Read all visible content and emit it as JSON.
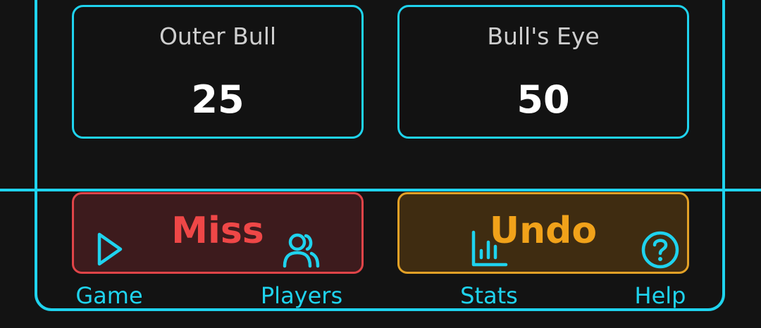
{
  "score_cards": [
    {
      "label": "Outer Bull",
      "value": "25"
    },
    {
      "label": "Bull's Eye",
      "value": "50"
    }
  ],
  "actions": {
    "miss_label": "Miss",
    "undo_label": "Undo"
  },
  "nav": {
    "items": [
      {
        "label": "Game",
        "icon": "play-icon"
      },
      {
        "label": "Players",
        "icon": "users-icon"
      },
      {
        "label": "Stats",
        "icon": "bar-chart-icon"
      },
      {
        "label": "Help",
        "icon": "help-circle-icon"
      }
    ]
  },
  "colors": {
    "accent": "#1fd3ee",
    "background": "#131313",
    "miss": "#ef4747",
    "undo": "#f1a21a"
  }
}
